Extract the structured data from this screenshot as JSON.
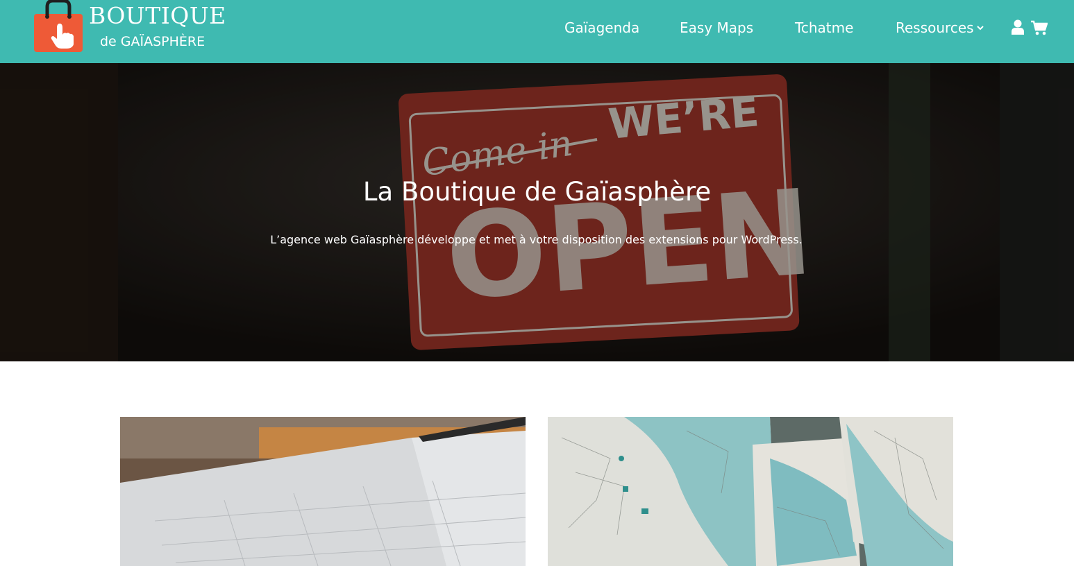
{
  "header": {
    "logo": {
      "title": "BOUTIQUE",
      "subtitle": "de GAÏASPHÈRE",
      "bag_color": "#ee5a37",
      "icon": "shopping-bag-hand-icon"
    },
    "nav": [
      {
        "label": "Gaïagenda"
      },
      {
        "label": "Easy Maps"
      },
      {
        "label": "Tchatme"
      },
      {
        "label": "Ressources",
        "has_dropdown": true
      }
    ],
    "icons": {
      "account": "user-icon",
      "cart": "cart-icon"
    },
    "background_color": "#3fbab1"
  },
  "hero": {
    "title": "La Boutique de Gaïasphère",
    "subtitle": "L’agence web Gaïasphère développe et met à votre disposition des extensions pour WordPress.",
    "image": {
      "description": "open sign",
      "sign_lines": [
        "Come in",
        "WE’RE",
        "OPEN"
      ],
      "sign_color": "#b03a2e"
    }
  },
  "cards": [
    {
      "image": "planner-calendar-photo"
    },
    {
      "image": "maps-photo"
    }
  ]
}
